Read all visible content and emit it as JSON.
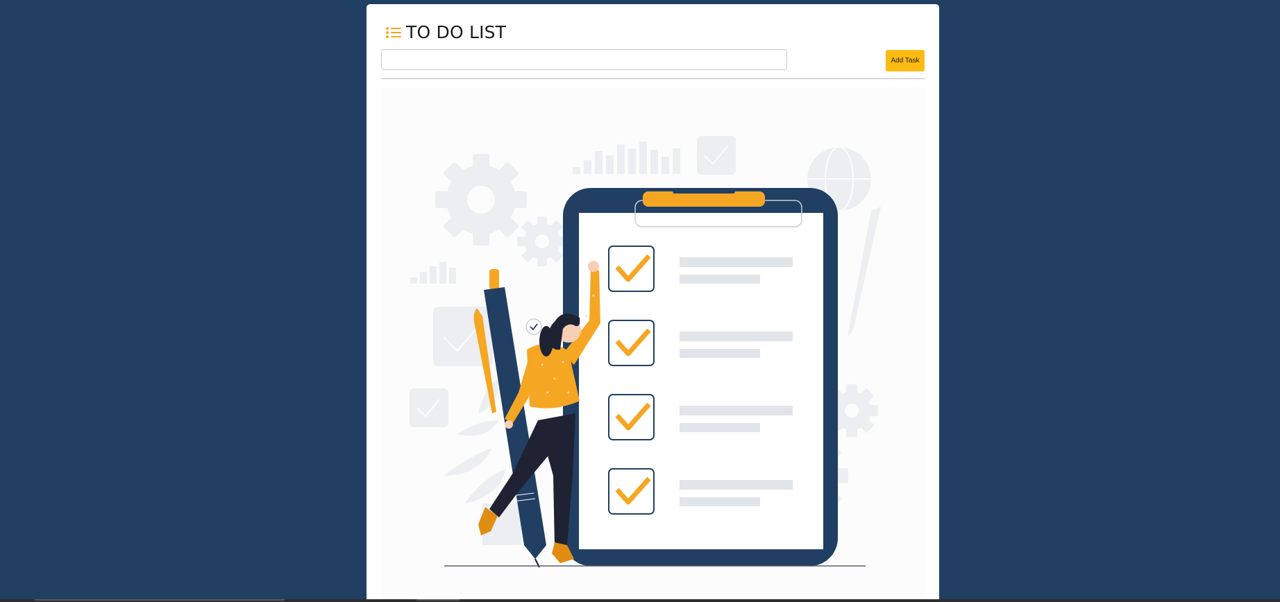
{
  "app": {
    "title": "TO DO LIST",
    "title_icon": "list-icon"
  },
  "task_form": {
    "input_value": "",
    "input_placeholder": "",
    "add_button_label": "Add Task"
  },
  "illustration": {
    "subject": "woman-checking-clipboard-checklist",
    "checkbox_count": 4
  },
  "colors": {
    "page_background": "#213f63",
    "card_background": "#ffffff",
    "accent": "#fbbb12",
    "navy": "#213f63",
    "illustration_orange": "#f5a623",
    "muted_shapes": "#eceef2"
  }
}
